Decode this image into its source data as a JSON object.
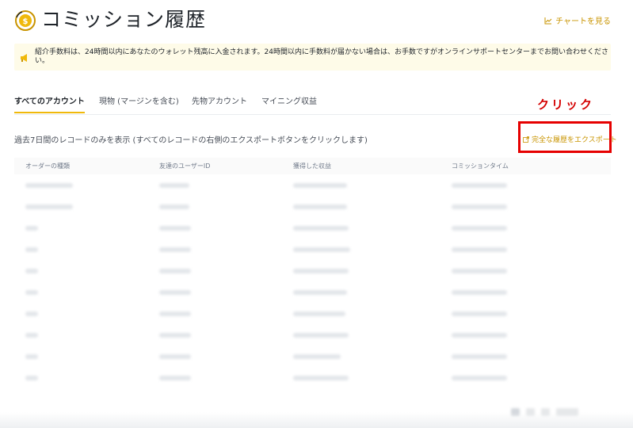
{
  "header": {
    "title": "コミッション履歴",
    "chart_link": "チャートを見る"
  },
  "notice": {
    "text": "紹介手数料は、24時間以内にあなたのウォレット残高に入金されます。24時間以内に手数料が届かない場合は、お手数ですがオンラインサポートセンターまでお問い合わせください。"
  },
  "tabs": [
    {
      "label": "すべてのアカウント",
      "active": true
    },
    {
      "label": "現物 (マージンを含む)",
      "active": false
    },
    {
      "label": "先物アカウント",
      "active": false
    },
    {
      "label": "マイニング収益",
      "active": false
    }
  ],
  "annotation": {
    "text": "クリック",
    "color": "#e60000"
  },
  "records": {
    "note": "過去7日間のレコードのみを表示 (すべてのレコードの右側のエクスポートボタンをクリックします)",
    "export_label": "完全な履歴をエクスポート"
  },
  "table": {
    "columns": [
      "オーダーの種類",
      "友達のユーザーID",
      "獲得した収益",
      "コミッションタイム"
    ]
  },
  "colors": {
    "accent": "#f0b90b",
    "link": "#c99400",
    "notice_bg": "#fefbe8"
  }
}
